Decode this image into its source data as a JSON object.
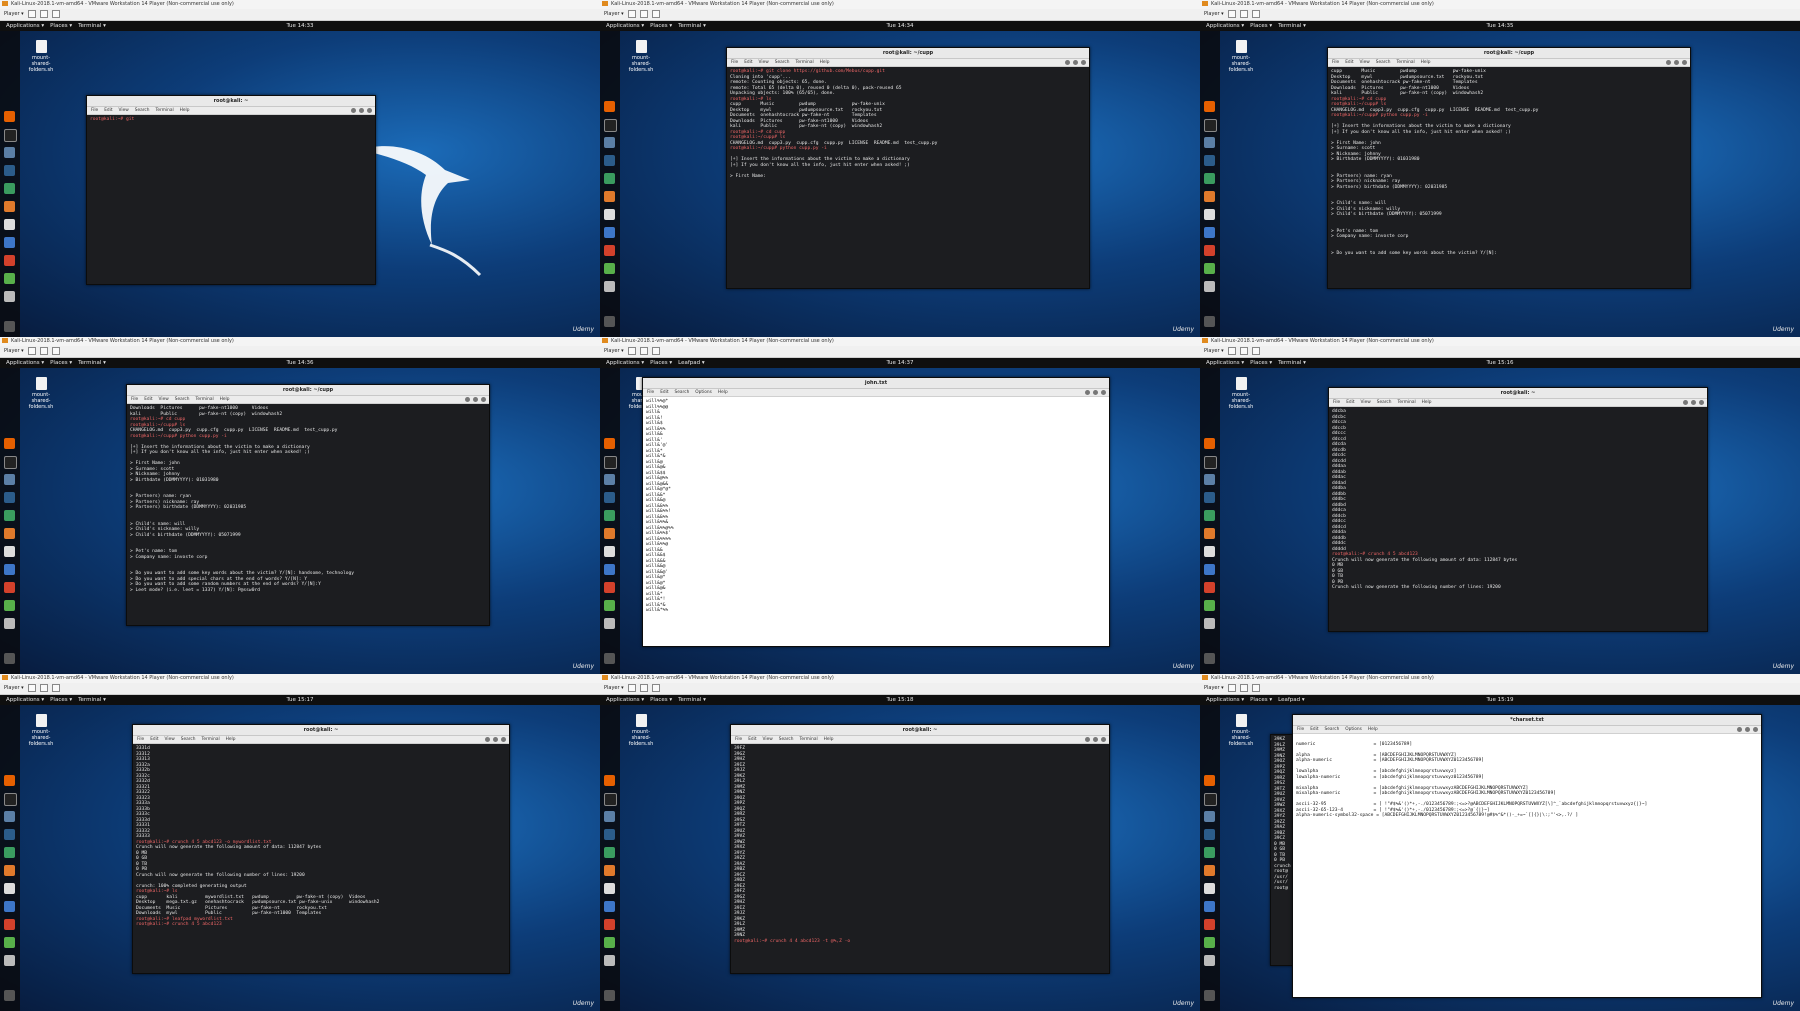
{
  "common": {
    "vm_title": "Kali-Linux-2018.1-vm-amd64 - VMware Workstation 14 Player (Non-commercial use only)",
    "player_menu": "Player ▾",
    "applications": "Applications ▾",
    "places": "Places ▾",
    "desktop_icon": "mount-shared-folders.sh",
    "watermark": "Udemy",
    "menubar": [
      "File",
      "Edit",
      "View",
      "Search",
      "Terminal",
      "Help"
    ],
    "colors": {
      "desktop": "#0d3d79",
      "terminal_bg": "#1c1d20",
      "prompt": "#e66666",
      "accent": "#4ea1ff"
    }
  },
  "tiles": [
    {
      "clock": "Tue 14:33",
      "active_app": "Terminal ▾",
      "window_title": "root@kali: ~",
      "lines": [
        "root@kali:~# git"
      ]
    },
    {
      "clock": "Tue 14:34",
      "active_app": "Terminal ▾",
      "window_title": "root@kali: ~/cupp",
      "lines": [
        "root@kali:~# git clone https://github.com/Mebus/cupp.git",
        "Cloning into 'cupp'...",
        "remote: Counting objects: 65, done.",
        "remote: Total 65 (delta 0), reused 0 (delta 0), pack-reused 65",
        "Unpacking objects: 100% (65/65), done.",
        "root@kali:~# ls",
        "cupp       Music         pwdump             pw-fake-unix",
        "Desktop    mywl          pwdumpsource.txt   rockyou.txt",
        "Documents  onehashtocrack pw-fake-nt        Templates",
        "Downloads  Pictures      pw-fake-nt1000     Videos",
        "kali       Public        pw-fake-nt (copy)  windowhash2",
        "root@kali:~# cd cupp",
        "root@kali:~/cupp# ls",
        "CHANGELOG.md  cupp3.py  cupp.cfg  cupp.py  LICENSE  README.md  test_cupp.py",
        "root@kali:~/cupp# python cupp.py -i",
        "",
        "[+] Insert the informations about the victim to make a dictionary",
        "[+] If you don't know all the info, just hit enter when asked! ;)",
        "",
        "> First Name: "
      ]
    },
    {
      "clock": "Tue 14:35",
      "active_app": "Terminal ▾",
      "window_title": "root@kali: ~/cupp",
      "lines": [
        "cupp       Music         pwdump             pw-fake-unix",
        "Desktop    mywl          pwdumpsource.txt   rockyou.txt",
        "Documents  onehashtocrack pw-fake-nt        Templates",
        "Downloads  Pictures      pw-fake-nt1000     Videos",
        "kali       Public        pw-fake-nt (copy)  windowhash2",
        "root@kali:~# cd cupp",
        "root@kali:~/cupp# ls",
        "CHANGELOG.md  cupp3.py  cupp.cfg  cupp.py  LICENSE  README.md  test_cupp.py",
        "root@kali:~/cupp# python cupp.py -i",
        "",
        "[+] Insert the informations about the victim to make a dictionary",
        "[+] If you don't know all the info, just hit enter when asked! ;)",
        "",
        "> First Name: john",
        "> Surname: scott",
        "> Nickname: johnny",
        "> Birthdate (DDMMYYYY): 01031980",
        "",
        "",
        "> Partners) name: ryan",
        "> Partners) nickname: ray",
        "> Partners) birthdate (DDMMYYYY): 02031985",
        "",
        "",
        "> Child's name: will",
        "> Child's nickname: willy",
        "> Child's birthdate (DDMMYYYY): 05071999",
        "",
        "",
        "> Pet's name: tom",
        "> Company name: invoste corp",
        "",
        "",
        "> Do you want to add some key words about the victim? Y/[N]: "
      ]
    },
    {
      "clock": "Tue 14:36",
      "active_app": "Terminal ▾",
      "window_title": "root@kali: ~/cupp",
      "lines": [
        "Downloads  Pictures      pw-fake-nt1000     Videos",
        "kali       Public        pw-fake-nt (copy)  windowhash2",
        "root@kali:~# cd cupp",
        "root@kali:~/cupp# ls",
        "CHANGELOG.md  cupp3.py  cupp.cfg  cupp.py  LICENSE  README.md  test_cupp.py",
        "root@kali:~/cupp# python cupp.py -i",
        "",
        "[+] Insert the informations about the victim to make a dictionary",
        "[+] If you don't know all the info, just hit enter when asked! ;)",
        "",
        "> First Name: john",
        "> Surname: scott",
        "> Nickname: johnny",
        "> Birthdate (DDMMYYYY): 01031980",
        "",
        "",
        "> Partners) name: ryan",
        "> Partners) nickname: ray",
        "> Partners) birthdate (DDMMYYYY): 02031985",
        "",
        "",
        "> Child's name: will",
        "> Child's nickname: willy",
        "> Child's birthdate (DDMMYYYY): 05071999",
        "",
        "",
        "> Pet's name: tom",
        "> Company name: invoste corp",
        "",
        "",
        "> Do you want to add some key words about the victim? Y/[N]: handsome, technology",
        "> Do you want to add special chars at the end of words? Y/[N]: Y",
        "> Do you want to add some random numbers at the end of words? Y/[N]:Y",
        "> Leet mode? (i.e. leet = 1337) Y/[N]: P@ssw0rd"
      ]
    },
    {
      "clock": "Tue 14:37",
      "active_app": "Leafpad ▾",
      "window_title": "john.txt",
      "menu": [
        "File",
        "Edit",
        "Search",
        "Options",
        "Help"
      ],
      "lines": [
        "will%%@*",
        "will%%@@",
        "will&",
        "will&!",
        "will&$",
        "will&%%",
        "will&&",
        "will&'",
        "will&'@'",
        "will&*",
        "will&*&",
        "will&@",
        "will&@&",
        "will&$$",
        "will&@%%",
        "will&@&&",
        "will&@*@*",
        "will&&*",
        "will&&@",
        "will&&%%",
        "will&&%%!",
        "will&&%%",
        "will&%%&",
        "will&%%@%%",
        "will&%%$'",
        "will&%%%%",
        "will&%%@",
        "will&&",
        "will&&$",
        "will&&&",
        "will&&@",
        "will&&@'",
        "will&@*",
        "will&@*",
        "will&@&",
        "will&*",
        "will&*!",
        "will&*&",
        "will&*%%"
      ]
    },
    {
      "clock": "Tue 15:16",
      "active_app": "Terminal ▾",
      "window_title": "root@kali: ~",
      "lines": [
        "ddcba",
        "ddcbc",
        "ddcca",
        "ddccb",
        "ddccc",
        "ddccd",
        "ddcda",
        "ddcdb",
        "ddcdc",
        "ddcdd",
        "dddaa",
        "dddab",
        "dddac",
        "dddad",
        "dddba",
        "dddbb",
        "dddbc",
        "dddbd",
        "dddca",
        "dddcb",
        "dddcc",
        "dddcd",
        "dddda",
        "ddddb",
        "ddddc",
        "ddddd",
        "root@kali:~# crunch 4 5 abcd123",
        "Crunch will now generate the following amount of data: 112847 bytes",
        "0 MB",
        "0 GB",
        "0 TB",
        "0 PB",
        "Crunch will now generate the following number of lines: 19200"
      ]
    },
    {
      "clock": "Tue 15:17",
      "active_app": "Terminal ▾",
      "window_title": "root@kali: ~",
      "lines": [
        "3331d",
        "33312",
        "33313",
        "3332a",
        "3332b",
        "3332c",
        "3332d",
        "33321",
        "33322",
        "33323",
        "3333a",
        "3333b",
        "3333c",
        "3333d",
        "33331",
        "33332",
        "33333",
        "root@kali:~# crunch 4 5 abcd123 -o mywordlist.txt",
        "Crunch will now generate the following amount of data: 112847 bytes",
        "0 MB",
        "0 GB",
        "0 TB",
        "0 PB",
        "Crunch will now generate the following number of lines: 19200",
        "",
        "crunch: 100% completed generating output",
        "root@kali:~# ls",
        "cupp       kali          mywordlist.txt   pwdump          pw-fake-nt (copy)  Videos",
        "Desktop    mega.txt.gz   onehashtocrack   pwdumpsource.txt pw-fake-unix      windowhash2",
        "Documents  Music         Pictures         pw-fake-nt      rockyou.txt",
        "Downloads  mywl          Public           pw-fake-nt1000  Templates",
        "root@kali:~# leafpad mywordlist.txt",
        "root@kali:~# crunch 4 5 abcd123 "
      ]
    },
    {
      "clock": "Tue 15:18",
      "active_app": "Terminal ▾",
      "window_title": "root@kali: ~",
      "lines": [
        "39FZ",
        "39GZ",
        "39HZ",
        "39IZ",
        "39JZ",
        "39KZ",
        "39LZ",
        "39MZ",
        "39NZ",
        "39OZ",
        "39PZ",
        "39QZ",
        "39RZ",
        "39SZ",
        "39TZ",
        "39UZ",
        "39VZ",
        "39WZ",
        "39XZ",
        "39YZ",
        "39ZZ",
        "39AZ",
        "39BZ",
        "39CZ",
        "39DZ",
        "39EZ",
        "39FZ",
        "39GZ",
        "39HZ",
        "39IZ",
        "39JZ",
        "39KZ",
        "39LZ",
        "39MZ",
        "39NZ",
        "root@kali:~# crunch 4 4 abcd123 -t @%,Z -o "
      ]
    },
    {
      "clock": "Tue 15:19",
      "active_app": "Leafpad ▾",
      "window_title": "*charset.txt",
      "menu": [
        "File",
        "Edit",
        "Search",
        "Options",
        "Help"
      ],
      "lines": [
        "",
        "numeric                     = [0123456789]",
        "",
        "alpha                       = [ABCDEFGHIJKLMNOPQRSTUVWXYZ]",
        "alpha-numeric               = [ABCDEFGHIJKLMNOPQRSTUVWXYZ0123456789]",
        "",
        "lowalpha                    = [abcdefghijklmnopqrstuvwxyz]",
        "lowalpha-numeric            = [abcdefghijklmnopqrstuvwxyz0123456789]",
        "",
        "mixalpha                    = [abcdefghijklmnopqrstuvwxyzABCDEFGHIJKLMNOPQRSTUVWXYZ]",
        "mixalpha-numeric            = [abcdefghijklmnopqrstuvwxyzABCDEFGHIJKLMNOPQRSTUVWXYZ0123456789]",
        "",
        "ascii-32-95                 = [ !\"#$%&'()*+,-./0123456789:;<=>?@ABCDEFGHIJKLMNOPQRSTUVWXYZ[\\]^_`abcdefghijklmnopqrstuvwxyz{|}~]",
        "ascii-32-65-123-4           = [ !\"#$%&'()*+,-./0123456789:;<=>?@`{|}~]",
        "alpha-numeric-symbol32-space = [ABCDEFGHIJKLMNOPQRSTUVWXYZ0123456789!@#$%^&*()-_+=~`[]{}|\\:;\"'<>,.?/ ]"
      ],
      "bg_terminal_lines": [
        "39KZ",
        "39LZ",
        "39MZ",
        "39NZ",
        "39OZ",
        "39PZ",
        "39QZ",
        "39RZ",
        "39SZ",
        "39TZ",
        "39UZ",
        "39VZ",
        "39WZ",
        "39XZ",
        "39YZ",
        "39ZZ",
        "39AZ",
        "39BZ",
        "39CZ",
        "0 MB",
        "0 GB",
        "0 TB",
        "0 PB",
        "crunch",
        "root@",
        "/usr/",
        "/usr/",
        "root@"
      ]
    }
  ]
}
